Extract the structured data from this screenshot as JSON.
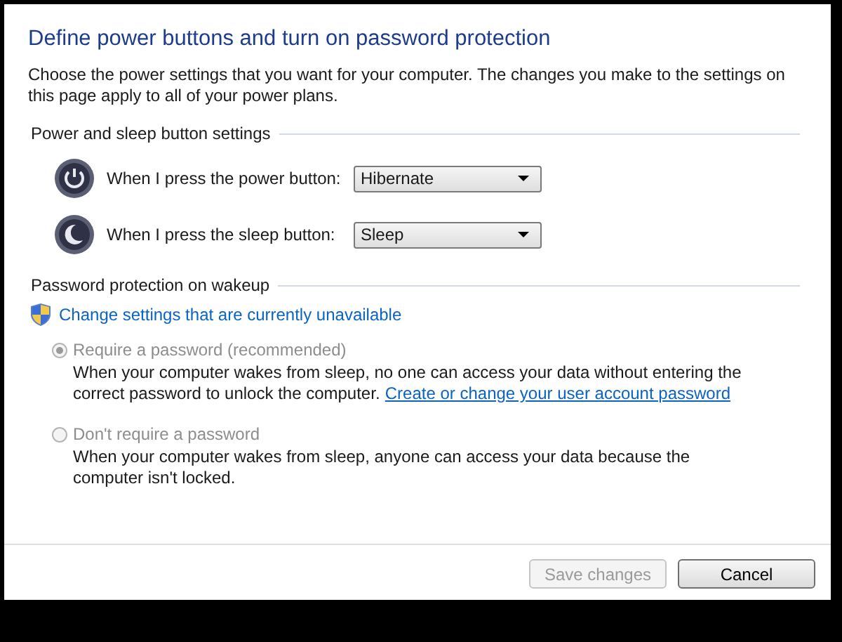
{
  "title": "Define power buttons and turn on password protection",
  "intro": "Choose the power settings that you want for your computer. The changes you make to the settings on this page apply to all of your power plans.",
  "button_settings": {
    "heading": "Power and sleep button settings",
    "rows": [
      {
        "kind": "power",
        "label": "When I press the power button:",
        "value": "Hibernate"
      },
      {
        "kind": "sleep",
        "label": "When I press the sleep button:",
        "value": "Sleep"
      }
    ]
  },
  "password": {
    "heading": "Password protection on wakeup",
    "link": "Change settings that are currently unavailable",
    "options": [
      {
        "label": "Require a password (recommended)",
        "selected": true,
        "disabled": true,
        "description": "When your computer wakes from sleep, no one can access your data without entering the correct password to unlock the computer.",
        "link": "Create or change your user account password"
      },
      {
        "label": "Don't require a password",
        "selected": false,
        "disabled": true,
        "description": "When your computer wakes from sleep, anyone can access your data because the computer isn't locked."
      }
    ]
  },
  "buttons": [
    {
      "label": "Save changes",
      "disabled": true
    },
    {
      "label": "Cancel",
      "disabled": false
    }
  ]
}
